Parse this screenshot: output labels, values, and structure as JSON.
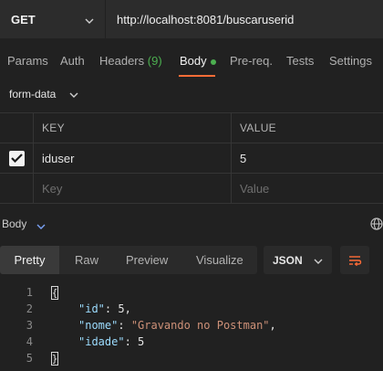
{
  "request": {
    "method": "GET",
    "url": "http://localhost:8081/buscaruserid"
  },
  "tabs": {
    "params": "Params",
    "auth": "Auth",
    "headers": "Headers",
    "headers_count": "(9)",
    "body": "Body",
    "prereq": "Pre-req.",
    "tests": "Tests",
    "settings": "Settings",
    "active": "Body"
  },
  "body_type": "form-data",
  "table": {
    "headers": [
      "KEY",
      "VALUE"
    ],
    "rows": [
      {
        "checked": true,
        "key": "iduser",
        "value": "5"
      }
    ],
    "key_placeholder": "Key",
    "value_placeholder": "Value"
  },
  "response": {
    "label": "Body",
    "view_tabs": [
      "Pretty",
      "Raw",
      "Preview",
      "Visualize"
    ],
    "active_view": "Pretty",
    "format": "JSON",
    "line_numbers": [
      "1",
      "2",
      "3",
      "4",
      "5"
    ],
    "json_lines": {
      "open": "{",
      "id_key": "\"id\"",
      "id_value": "5",
      "nome_key": "\"nome\"",
      "nome_value": "\"Gravando no Postman\"",
      "idade_key": "\"idade\"",
      "idade_value": "5",
      "close": "}"
    }
  },
  "colors": {
    "accent": "#ff6c37",
    "success": "#4caf50",
    "json_key": "#9cdcfe",
    "json_string": "#ce9178"
  }
}
